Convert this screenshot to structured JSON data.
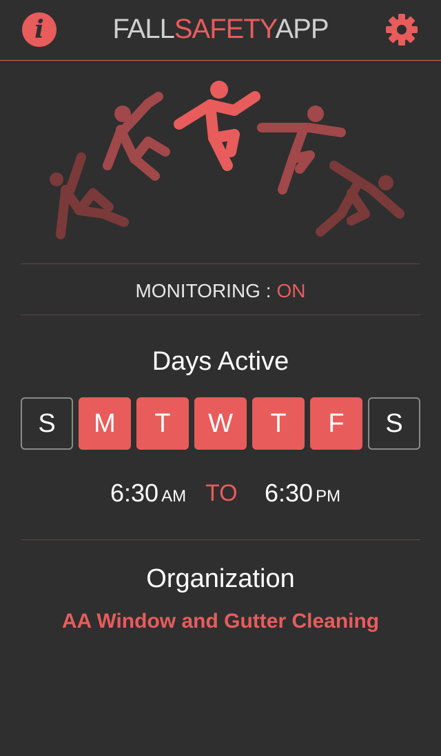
{
  "header": {
    "title_part1": "FALL",
    "title_part2": "SAFETY",
    "title_part3": "APP",
    "info_label": "i",
    "info_icon": "info-icon",
    "settings_icon": "gear-icon"
  },
  "hero": {
    "icon": "falling-person-sequence-icon"
  },
  "monitoring": {
    "label": "MONITORING :",
    "status": "ON"
  },
  "days": {
    "title": "Days Active",
    "items": [
      {
        "label": "S",
        "active": false
      },
      {
        "label": "M",
        "active": true
      },
      {
        "label": "T",
        "active": true
      },
      {
        "label": "W",
        "active": true
      },
      {
        "label": "T",
        "active": true
      },
      {
        "label": "F",
        "active": true
      },
      {
        "label": "S",
        "active": false
      }
    ]
  },
  "schedule": {
    "start_time": "6:30",
    "start_ampm": "AM",
    "separator": "TO",
    "end_time": "6:30",
    "end_ampm": "PM"
  },
  "organization": {
    "title": "Organization",
    "name": "AA Window and Gutter Cleaning"
  },
  "colors": {
    "accent": "#e85c5c",
    "background": "#2f2f2f",
    "text": "#ffffff"
  }
}
